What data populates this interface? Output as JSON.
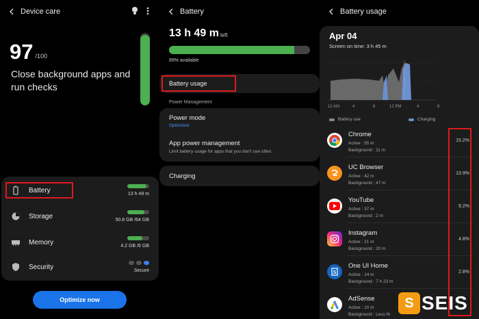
{
  "panel1": {
    "title": "Device care",
    "score": "97",
    "score_max": "/100",
    "message": "Close background apps and run checks",
    "score_level": 0.97,
    "rows": [
      {
        "label": "Battery",
        "value": "13 h 49 m",
        "level": 0.89
      },
      {
        "label": "Storage",
        "value": "50.8 GB /64 GB",
        "level": 0.79
      },
      {
        "label": "Memory",
        "value": "4.2 GB /6 GB",
        "level": 0.7
      },
      {
        "label": "Security",
        "value": "Secure"
      }
    ],
    "optimize_label": "Optimize now"
  },
  "panel2": {
    "title": "Battery",
    "time_left": "13 h 49 m",
    "time_left_suffix": "left",
    "available": "89% available",
    "battery_level": 0.89,
    "battery_usage_label": "Battery usage",
    "section_label": "Power Management",
    "power_mode_title": "Power mode",
    "power_mode_value": "Optimized",
    "app_power_title": "App power management",
    "app_power_desc": "Limit battery usage for apps that you don't use often.",
    "charging_label": "Charging"
  },
  "panel3": {
    "title": "Battery usage",
    "date": "Apr 04",
    "screen_on": "Screen on time: 3 h 45 m",
    "x_ticks": [
      "12 AM",
      "4",
      "8",
      "12 PM",
      "4",
      "8"
    ],
    "legend_use": "Battery use",
    "legend_charging": "Charging",
    "apps": [
      {
        "name": "Chrome",
        "active": "Active : 55 m",
        "background": "Background : 11 m",
        "pct": "15.2%"
      },
      {
        "name": "UC Browser",
        "active": "Active : 42 m",
        "background": "Background : 47 m",
        "pct": "13.9%"
      },
      {
        "name": "YouTube",
        "active": "Active : 37 m",
        "background": "Background : 2 m",
        "pct": "9.2%"
      },
      {
        "name": "Instagram",
        "active": "Active : 21 m",
        "background": "Background : 20 m",
        "pct": "4.8%"
      },
      {
        "name": "One UI Home",
        "active": "Active : 14 m",
        "background": "Background : 7 h 23 m",
        "pct": "2.8%"
      },
      {
        "name": "AdSense",
        "active": "Active : 10 m",
        "background": "Background : Less th",
        "pct": ""
      }
    ]
  },
  "watermark": {
    "logo": "S",
    "text": "SEIS"
  },
  "colors": {
    "accent": "#1a73e8",
    "green": "#4caf50",
    "highlight": "#e0191e",
    "card": "#1c1c1c"
  }
}
